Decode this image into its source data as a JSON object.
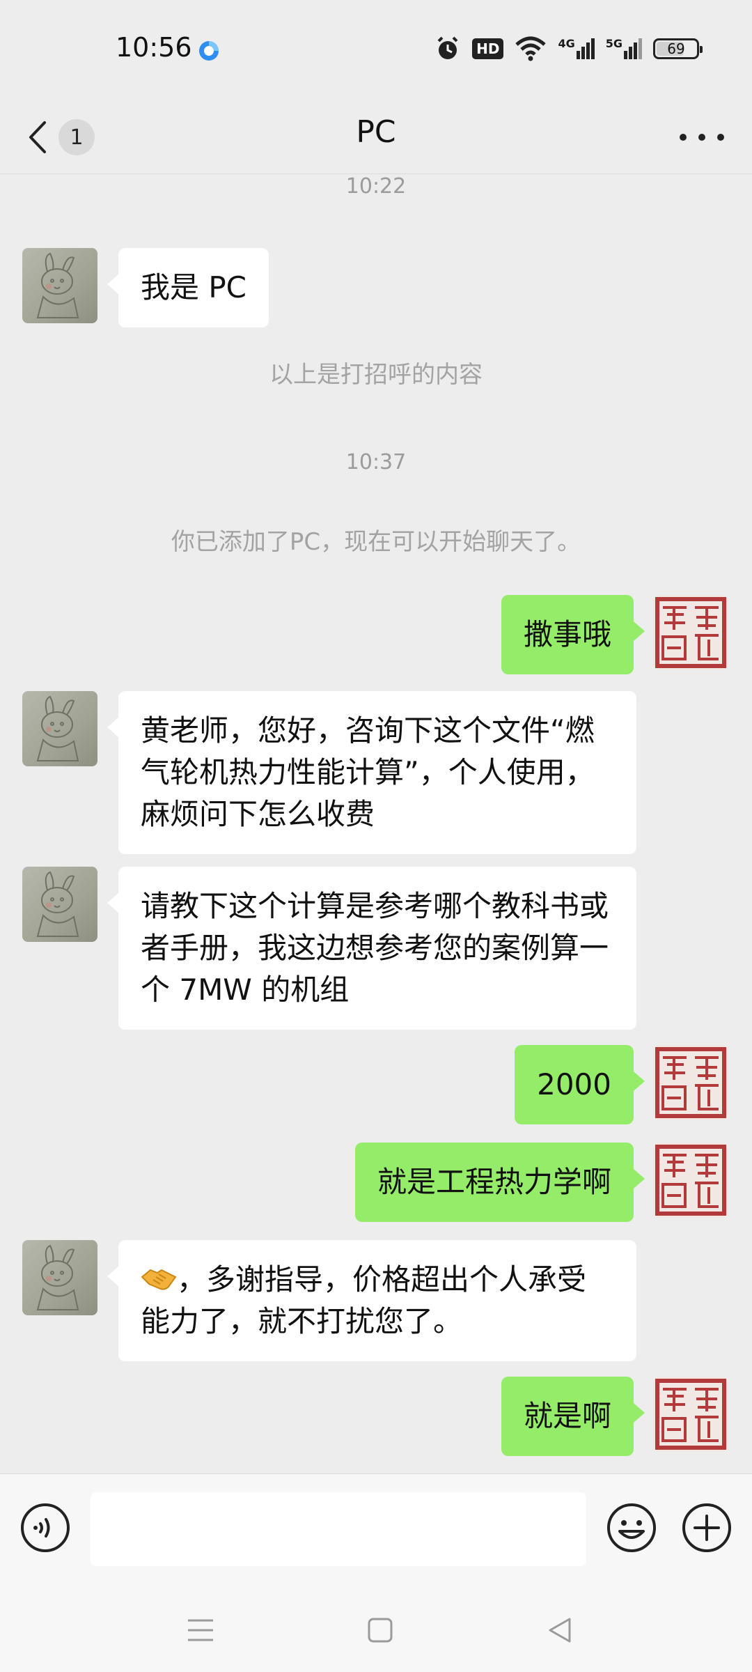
{
  "status_bar": {
    "time": "10:56",
    "battery_level": "69",
    "network_1": "4G",
    "network_2": "5G",
    "hd_label": "HD"
  },
  "header": {
    "back_badge": "1",
    "title": "PC"
  },
  "messages": {
    "ts1": "10:22",
    "m1": "我是 PC",
    "sys1": "以上是打招呼的内容",
    "ts2": "10:37",
    "sys2": "你已添加了PC，现在可以开始聊天了。",
    "m2": "撒事哦",
    "m3": "黄老师，您好，咨询下这个文件“燃气轮机热力性能计算”，个人使用，麻烦问下怎么收费",
    "m4": "请教下这个计算是参考哪个教科书或者手册，我这边想参考您的案例算一个 7MW 的机组",
    "m5": "2000",
    "m6": "就是工程热力学啊",
    "m7_emoji": "handshake-emoji",
    "m7": "，多谢指导，价格超出个人承受能力了，就不打扰您了。",
    "m8": "就是啊"
  },
  "input": {
    "placeholder": ""
  },
  "colors": {
    "background": "#ededed",
    "sent_bubble": "#95ec69",
    "received_bubble": "#ffffff",
    "muted_text": "#9b9b9b"
  }
}
